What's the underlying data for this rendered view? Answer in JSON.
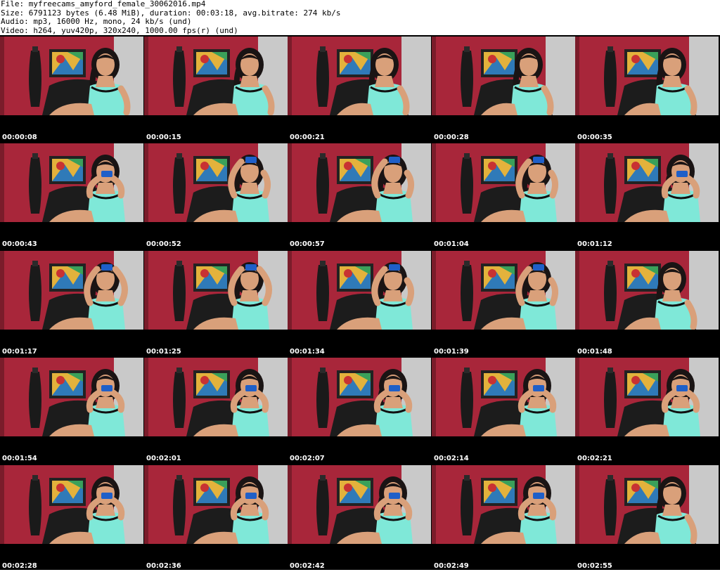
{
  "header": {
    "file_line": "File: myfreecams_amyford_female_30062016.mp4",
    "size_line": "Size: 6791123 bytes (6.48 MiB), duration: 00:03:18, avg.bitrate: 274 kb/s",
    "audio_line": "Audio: mp3, 16000 Hz, mono, 24 kb/s (und)",
    "video_line": "Video: h264, yuv420p, 320x240, 1000.00 fps(r) (und)"
  },
  "colors": {
    "sheet_bg": "#000000",
    "wall_red": "#a8263a",
    "wall_grey": "#c9c9c9",
    "top_dress": "#7fe8d8",
    "skin": "#d9a07a",
    "hair": "#1a1414",
    "chair": "#1c1c1c",
    "cup_blue": "#1f5fc8",
    "timestamp_text": "#ffffff"
  },
  "thumbnails": [
    {
      "time": "00:00:08",
      "pose": "sit",
      "cup": false
    },
    {
      "time": "00:00:15",
      "pose": "sit",
      "cup": false
    },
    {
      "time": "00:00:21",
      "pose": "lean",
      "cup": false
    },
    {
      "time": "00:00:28",
      "pose": "lean",
      "cup": false
    },
    {
      "time": "00:00:35",
      "pose": "lean",
      "cup": false
    },
    {
      "time": "00:00:43",
      "pose": "cup",
      "cup": true
    },
    {
      "time": "00:00:52",
      "pose": "armup",
      "cup": true
    },
    {
      "time": "00:00:57",
      "pose": "armup",
      "cup": true
    },
    {
      "time": "00:01:04",
      "pose": "armup",
      "cup": true
    },
    {
      "time": "00:01:12",
      "pose": "cup",
      "cup": true
    },
    {
      "time": "00:01:17",
      "pose": "armsup",
      "cup": true
    },
    {
      "time": "00:01:25",
      "pose": "armsup",
      "cup": true
    },
    {
      "time": "00:01:34",
      "pose": "armup",
      "cup": true
    },
    {
      "time": "00:01:39",
      "pose": "armup",
      "cup": true
    },
    {
      "time": "00:01:48",
      "pose": "lean",
      "cup": false
    },
    {
      "time": "00:01:54",
      "pose": "cup",
      "cup": true
    },
    {
      "time": "00:02:01",
      "pose": "cup",
      "cup": true
    },
    {
      "time": "00:02:07",
      "pose": "cup",
      "cup": true
    },
    {
      "time": "00:02:14",
      "pose": "cup",
      "cup": true
    },
    {
      "time": "00:02:21",
      "pose": "cup",
      "cup": true
    },
    {
      "time": "00:02:28",
      "pose": "cup",
      "cup": true
    },
    {
      "time": "00:02:36",
      "pose": "cup",
      "cup": true
    },
    {
      "time": "00:02:42",
      "pose": "cup",
      "cup": true
    },
    {
      "time": "00:02:49",
      "pose": "cup",
      "cup": true
    },
    {
      "time": "00:02:55",
      "pose": "lean",
      "cup": false
    }
  ]
}
